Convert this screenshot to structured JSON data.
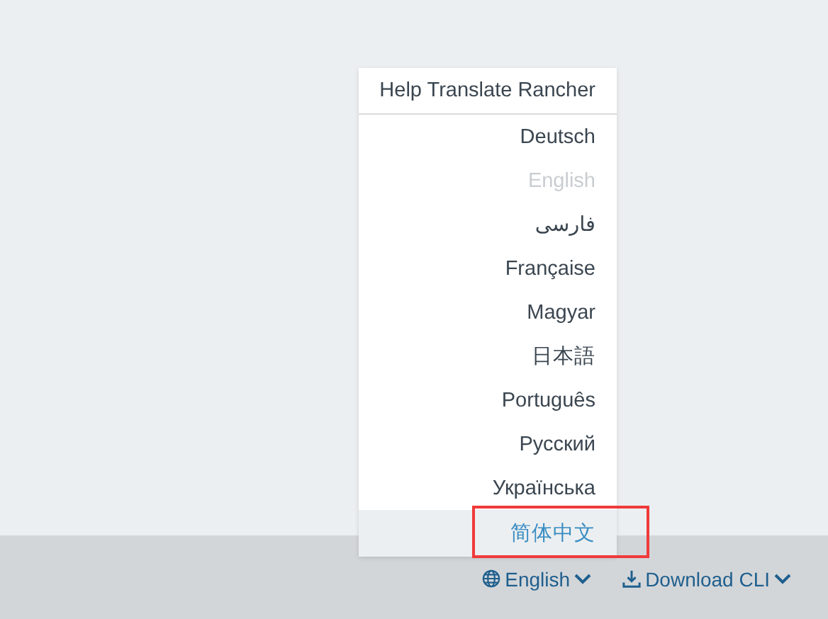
{
  "language_menu": {
    "header": "Help Translate Rancher",
    "items": [
      {
        "label": "Deutsch",
        "disabled": false,
        "hovered": false
      },
      {
        "label": "English",
        "disabled": true,
        "hovered": false
      },
      {
        "label": "فارسی",
        "disabled": false,
        "hovered": false
      },
      {
        "label": "Française",
        "disabled": false,
        "hovered": false
      },
      {
        "label": "Magyar",
        "disabled": false,
        "hovered": false
      },
      {
        "label": "日本語",
        "disabled": false,
        "hovered": false
      },
      {
        "label": "Português",
        "disabled": false,
        "hovered": false
      },
      {
        "label": "Русский",
        "disabled": false,
        "hovered": false
      },
      {
        "label": "Українська",
        "disabled": false,
        "hovered": false
      },
      {
        "label": "简体中文",
        "disabled": false,
        "hovered": true
      }
    ]
  },
  "footer": {
    "language_button": "English",
    "download_button": "Download CLI"
  }
}
